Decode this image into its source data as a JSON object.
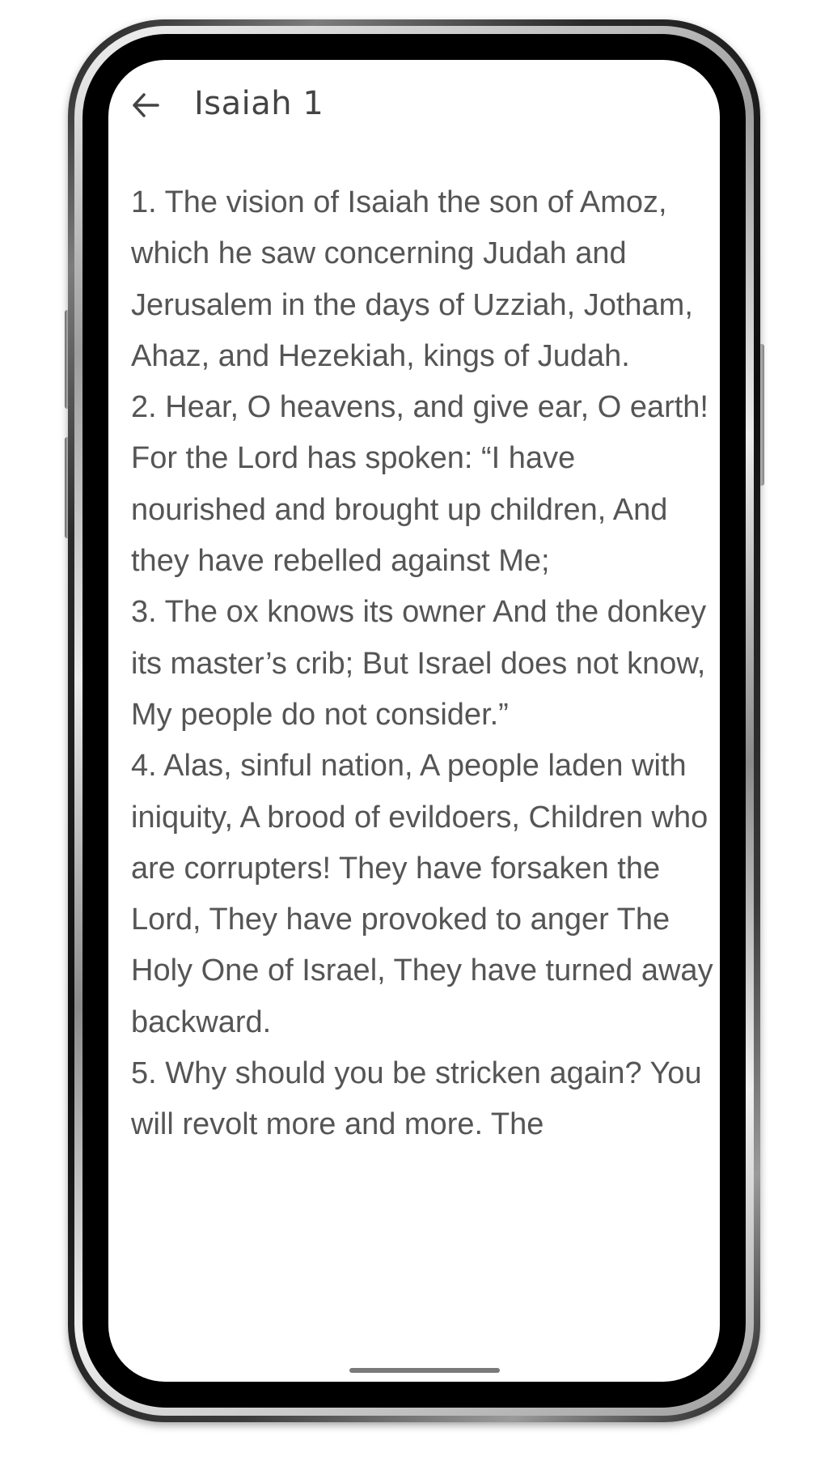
{
  "header": {
    "back_icon": "arrow-left-icon",
    "title": "Isaiah 1"
  },
  "verses": [
    {
      "number": "1",
      "text": "1. The vision of Isaiah the son of Amoz, which he saw concerning Judah and Jerusalem in the days of Uzziah, Jotham, Ahaz, and Hezekiah, kings of Judah."
    },
    {
      "number": "2",
      "text": "2. Hear, O heavens, and give ear, O earth! For the Lord has spoken: “I have nourished and brought up children, And they have rebelled against Me;"
    },
    {
      "number": "3",
      "text": "3. The ox knows its owner And the donkey its master’s crib; But Israel does not know, My people do not consider.”"
    },
    {
      "number": "4",
      "text": "4. Alas, sinful nation, A people laden with iniquity, A brood of evildoers, Children who are corrupters! They have forsaken the Lord, They have provoked to anger The Holy One of Israel, They have turned away backward."
    },
    {
      "number": "5",
      "text": "5. Why should you be stricken again? You will revolt more and more. The"
    }
  ],
  "colors": {
    "text": "#555555",
    "title": "#444444",
    "background": "#ffffff"
  }
}
